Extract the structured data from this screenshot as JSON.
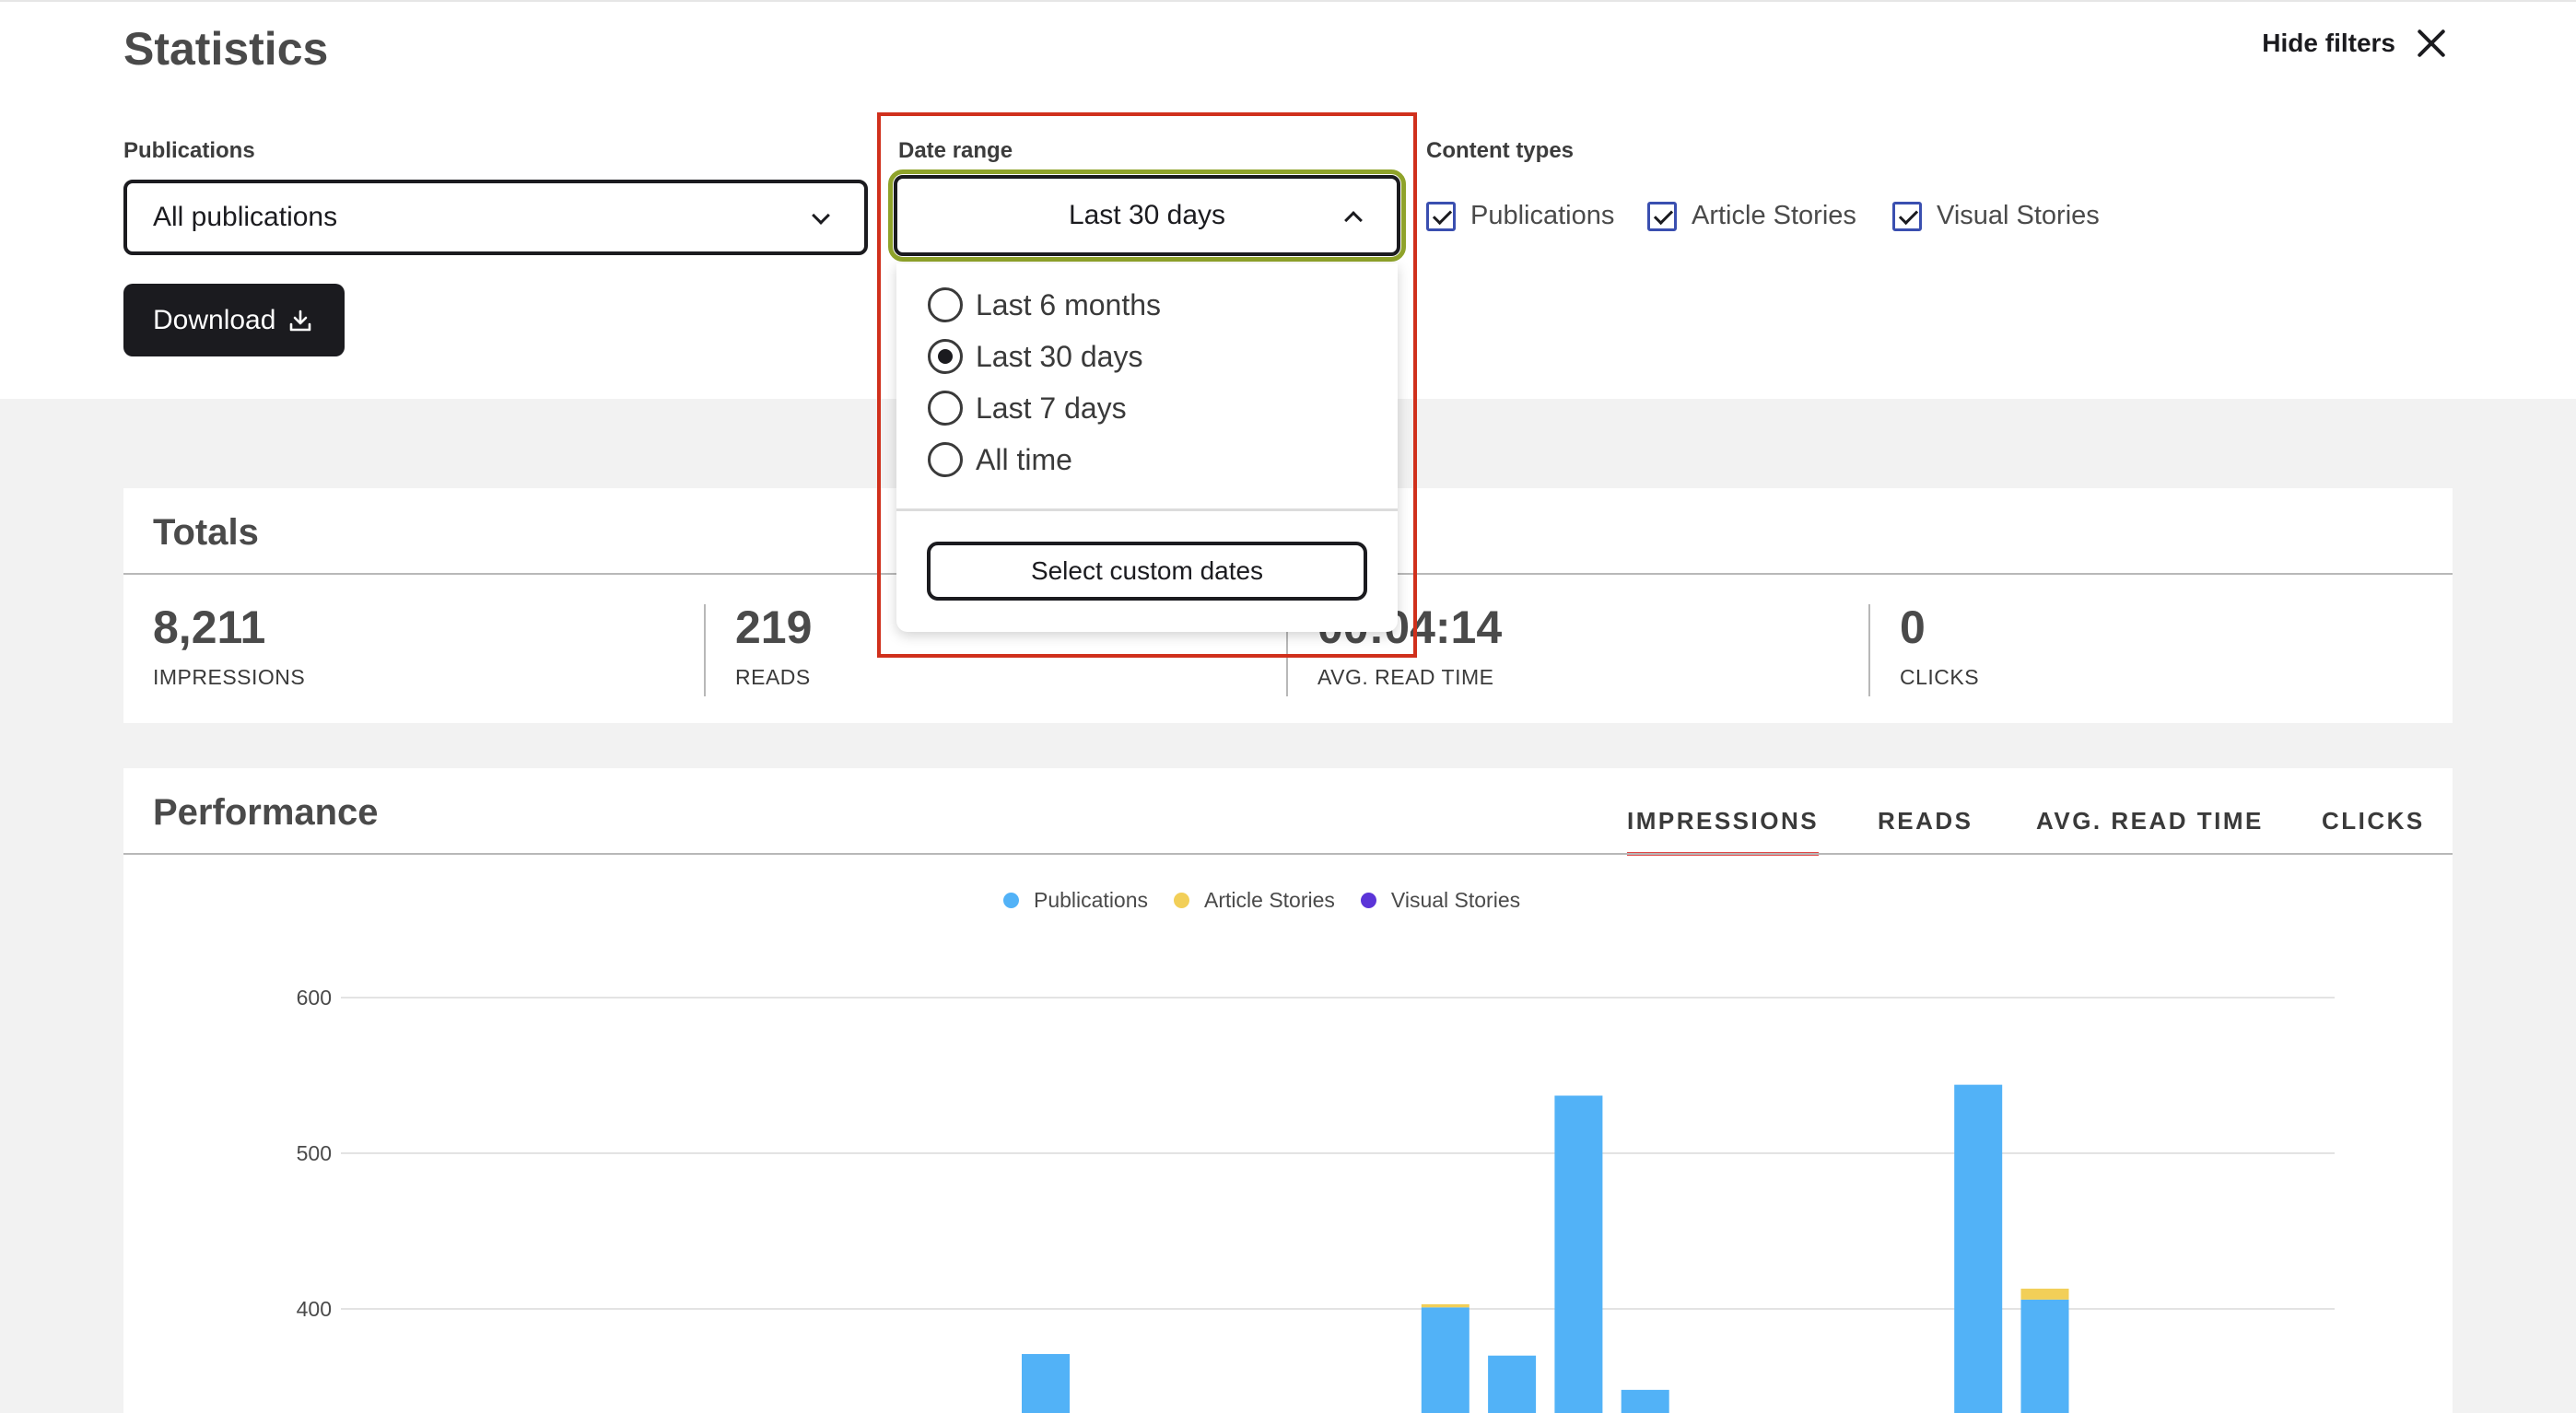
{
  "page": {
    "title": "Statistics",
    "hide_filters_label": "Hide filters"
  },
  "filters": {
    "publications_label": "Publications",
    "publications_value": "All publications",
    "download_label": "Download",
    "date_range_label": "Date range",
    "date_range_value": "Last 30 days",
    "date_options": [
      {
        "label": "Last 6 months",
        "checked": false
      },
      {
        "label": "Last 30 days",
        "checked": true
      },
      {
        "label": "Last 7 days",
        "checked": false
      },
      {
        "label": "All time",
        "checked": false
      }
    ],
    "custom_dates_label": "Select custom dates",
    "content_types_label": "Content types",
    "content_types": [
      {
        "label": "Publications",
        "checked": true
      },
      {
        "label": "Article Stories",
        "checked": true
      },
      {
        "label": "Visual Stories",
        "checked": true
      }
    ]
  },
  "totals": {
    "title": "Totals",
    "metrics": [
      {
        "value": "8,211",
        "label": "IMPRESSIONS"
      },
      {
        "value": "219",
        "label": "READS"
      },
      {
        "value": "00:04:14",
        "label": "AVG. READ TIME"
      },
      {
        "value": "0",
        "label": "CLICKS"
      }
    ]
  },
  "performance": {
    "title": "Performance",
    "tabs": [
      {
        "label": "IMPRESSIONS",
        "active": true
      },
      {
        "label": "READS",
        "active": false
      },
      {
        "label": "AVG. READ TIME",
        "active": false
      },
      {
        "label": "CLICKS",
        "active": false
      }
    ]
  },
  "colors": {
    "publications": "#52b2f7",
    "article_stories": "#f2cf58",
    "visual_stories": "#5b34d8",
    "accent_tab": "#e04848",
    "highlight": "#d0301c"
  },
  "chart_data": {
    "type": "bar",
    "stacked": true,
    "ylim_visible": [
      340,
      600
    ],
    "y_ticks": [
      400,
      500,
      600
    ],
    "legend": [
      "Publications",
      "Article Stories",
      "Visual Stories"
    ],
    "grid": true,
    "visible_bars": [
      {
        "slot": 10,
        "series": [
          {
            "name": "Publications",
            "value": 371
          }
        ]
      },
      {
        "slot": 16,
        "series": [
          {
            "name": "Publications",
            "value": 401
          },
          {
            "name": "Article Stories",
            "value": 2
          }
        ]
      },
      {
        "slot": 17,
        "series": [
          {
            "name": "Publications",
            "value": 370
          }
        ]
      },
      {
        "slot": 18,
        "series": [
          {
            "name": "Publications",
            "value": 537
          }
        ]
      },
      {
        "slot": 19,
        "series": [
          {
            "name": "Publications",
            "value": 348
          }
        ]
      },
      {
        "slot": 24,
        "series": [
          {
            "name": "Publications",
            "value": 544
          }
        ]
      },
      {
        "slot": 25,
        "series": [
          {
            "name": "Publications",
            "value": 406
          },
          {
            "name": "Article Stories",
            "value": 7
          }
        ]
      }
    ]
  }
}
